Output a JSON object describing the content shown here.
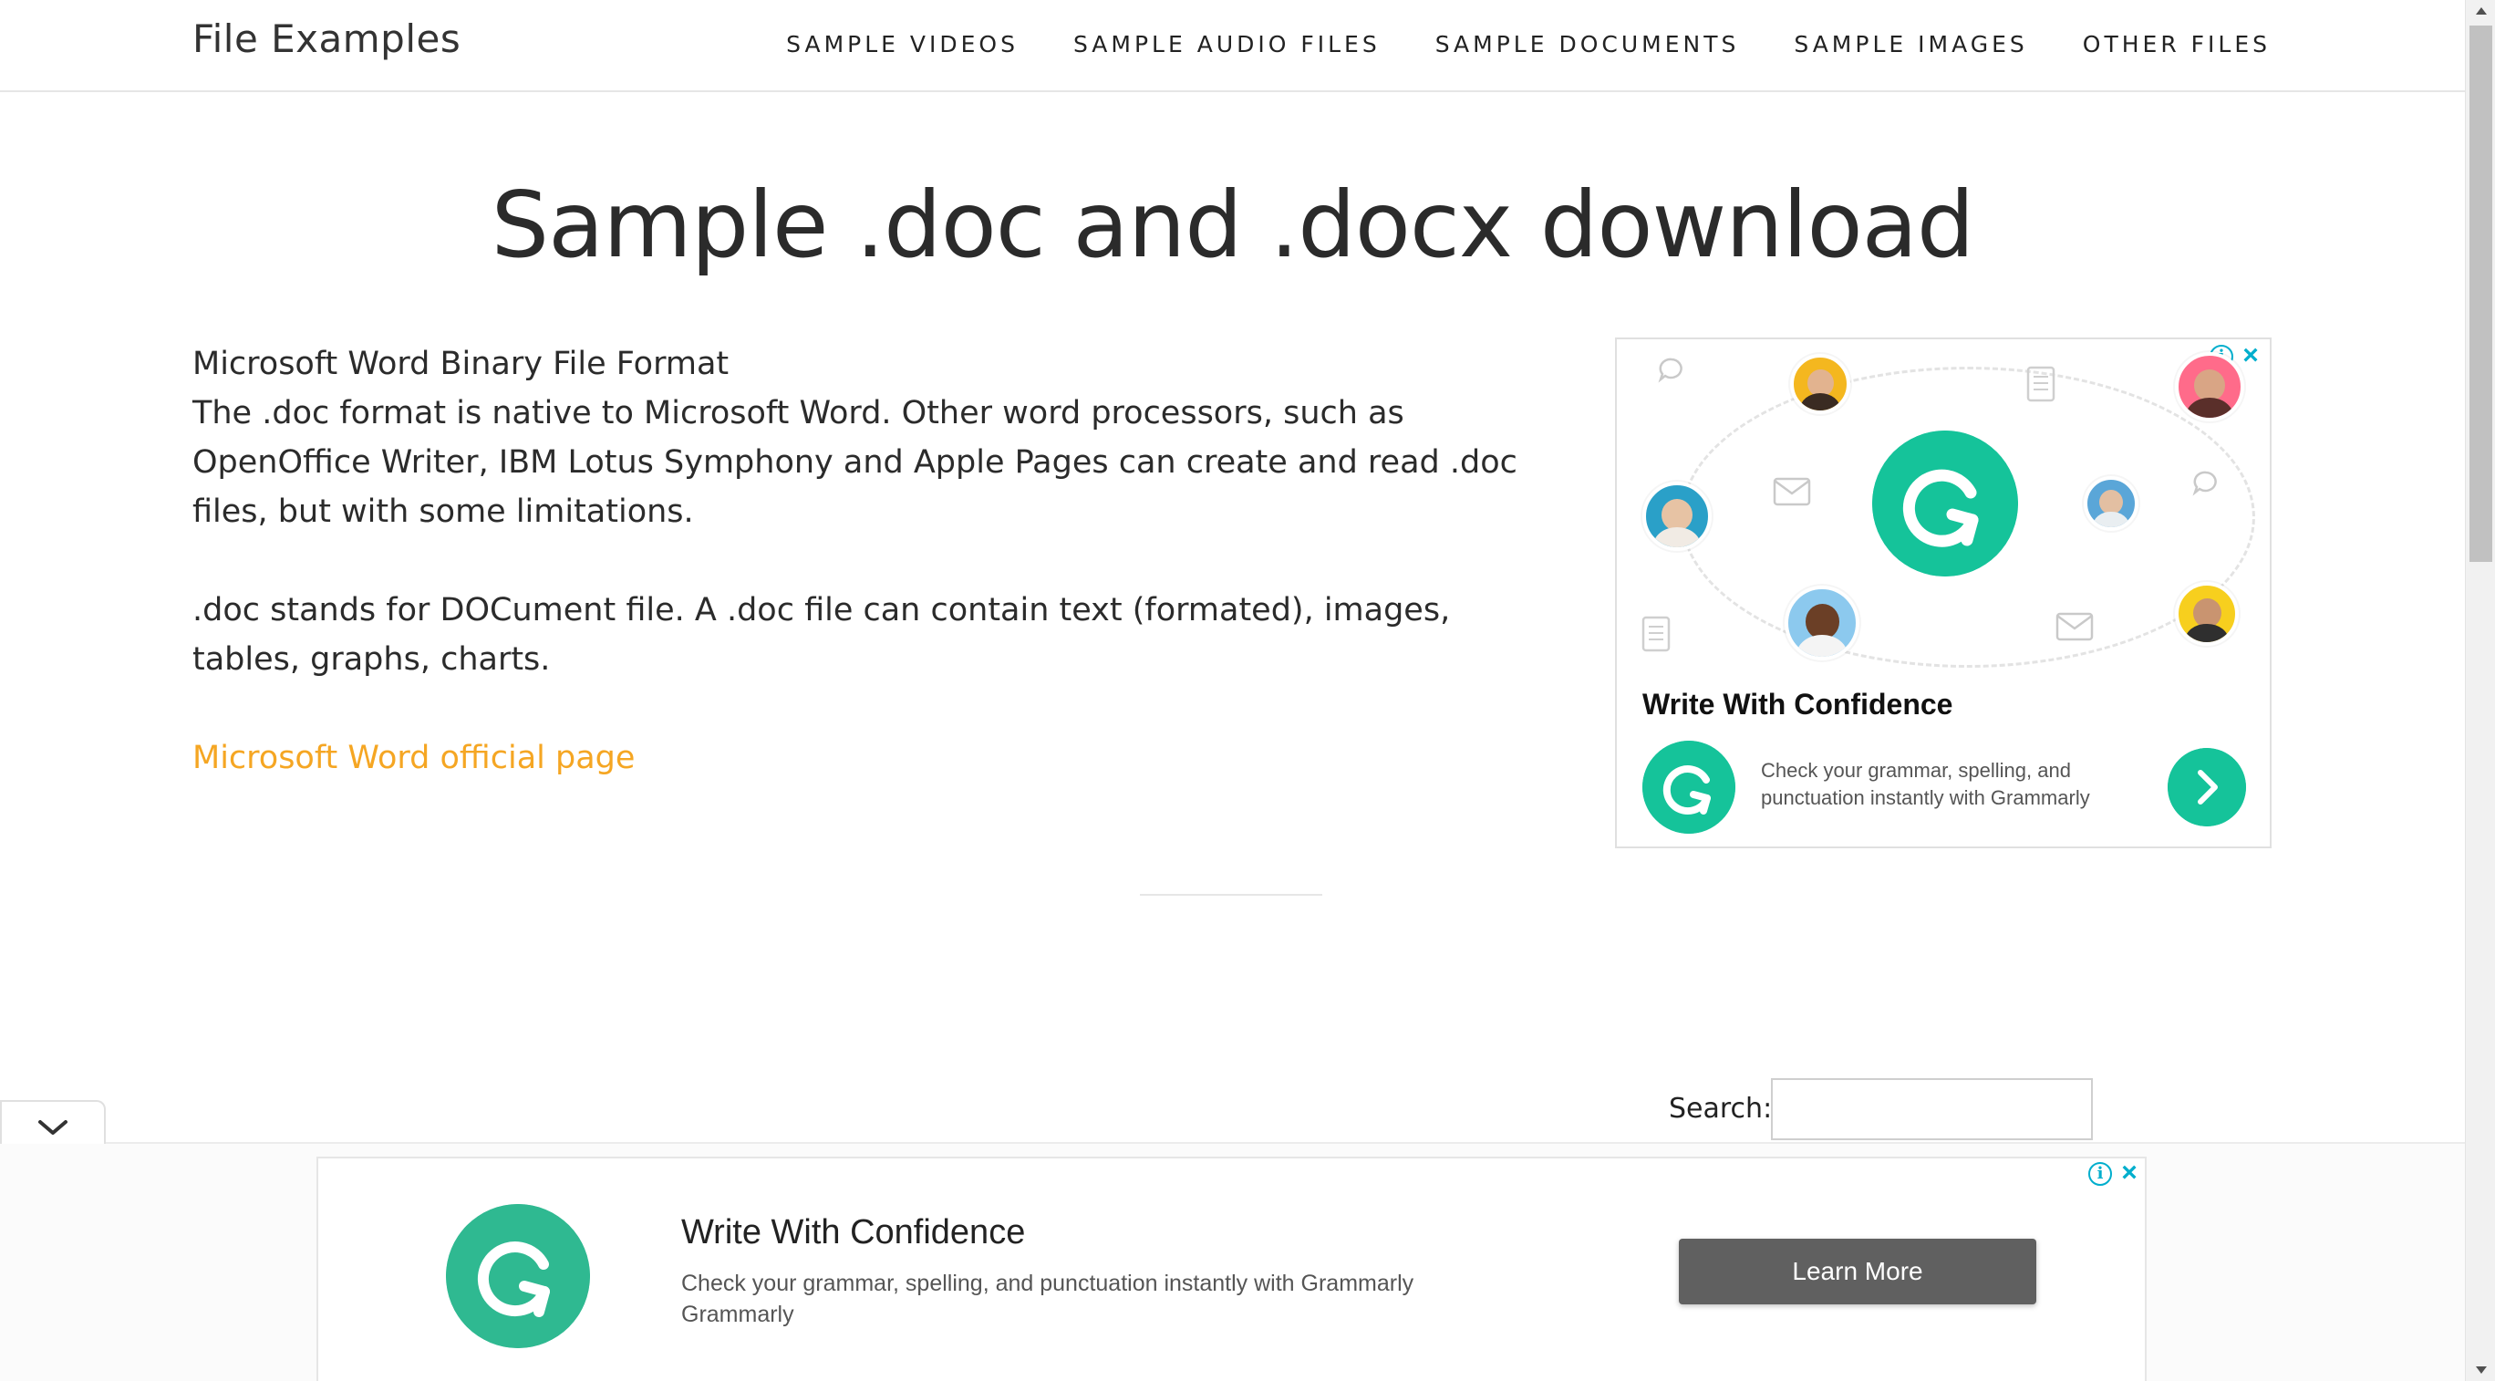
{
  "header": {
    "brand": "File Examples",
    "nav": [
      "SAMPLE VIDEOS",
      "SAMPLE AUDIO FILES",
      "SAMPLE DOCUMENTS",
      "SAMPLE IMAGES",
      "OTHER FILES"
    ]
  },
  "main": {
    "title": "Sample .doc and .docx download",
    "subtitle": "Microsoft Word Binary File Format",
    "paragraph1": "The .doc format is native to Microsoft Word. Other word processors, such as OpenOffice Writer, IBM Lotus Symphony and Apple Pages can create and read .doc files, but with some limitations.",
    "paragraph2": ".doc stands for DOCument file. A .doc file can contain text (formated), images, tables, graphs, charts.",
    "link": "Microsoft Word official page"
  },
  "side_ad": {
    "headline": "Write With Confidence",
    "body": "Check your grammar, spelling, and punctuation instantly with Grammarly",
    "info_icon": "i",
    "close_icon": "×",
    "accent": "#15c39a"
  },
  "search": {
    "label": "Search:",
    "value": ""
  },
  "bottom_ad": {
    "title": "Write With Confidence",
    "body": "Check your grammar, spelling, and punctuation instantly with Grammarly",
    "brand": "Grammarly",
    "button": "Learn More",
    "info_icon": "i",
    "close_icon": "×"
  },
  "colors": {
    "link": "#f5a623",
    "grammarly_green": "#15c39a",
    "button": "#606060"
  }
}
